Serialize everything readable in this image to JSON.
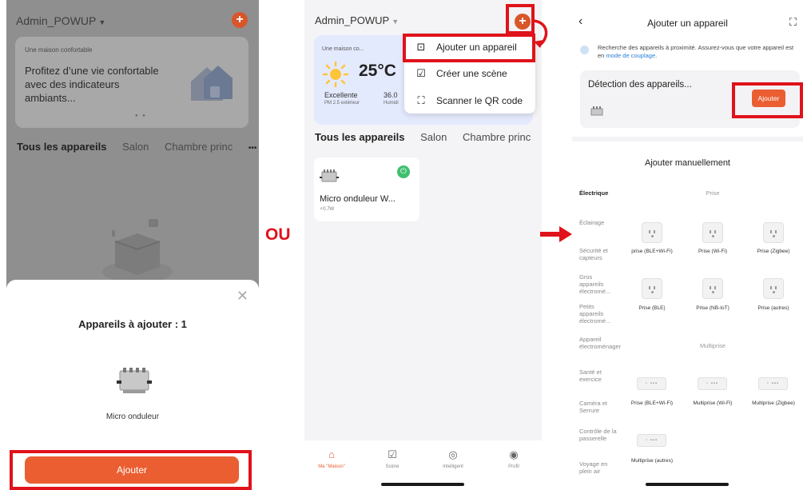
{
  "phone1": {
    "home_title": "Admin_POWUP",
    "card_small": "Une maison confortable",
    "card_big": "Profitez d’une vie confortable avec des indicateurs ambiants...",
    "tabs": [
      "Tous les appareils",
      "Salon",
      "Chambre princ"
    ],
    "more": "•••",
    "sheet": {
      "close": "✕",
      "title": "Appareils à ajouter : 1",
      "device_name": "Micro onduleur",
      "add_button": "Ajouter"
    }
  },
  "separator_text": "OU",
  "phone2": {
    "home_title": "Admin_POWUP",
    "card_location": "Une maison co...",
    "temperature": "25°C",
    "air_quality": "Excellente",
    "air_quality_sub": "PM 2.5 extérieur",
    "humidity": "36.0",
    "humidity_sub": "Humidi",
    "menu": [
      {
        "icon": "add-device-icon",
        "label": "Ajouter un appareil"
      },
      {
        "icon": "create-scene-icon",
        "label": "Créer une scène"
      },
      {
        "icon": "scan-qr-icon",
        "label": "Scanner le QR code"
      }
    ],
    "tabs": [
      "Tous les appareils",
      "Salon",
      "Chambre princ"
    ],
    "more": "•••",
    "device": {
      "name": "Micro onduleur W...",
      "power": "0.7W"
    },
    "nav": [
      {
        "icon": "home-icon",
        "label": "Ma \"Maison\""
      },
      {
        "icon": "scene-icon",
        "label": "Scène"
      },
      {
        "icon": "smart-icon",
        "label": "Intelligent"
      },
      {
        "icon": "profile-icon",
        "label": "Profil"
      }
    ]
  },
  "phone3": {
    "title": "Ajouter un appareil",
    "info_text": "Recherche des appareils à proximité. Assurez-vous que votre appareil est en ",
    "info_link": "mode de couplage",
    "info_end": ".",
    "detect_label": "Détection des appareils...",
    "detect_button": "Ajouter",
    "manual_title": "Ajouter manuellement",
    "categories": [
      "Électrique",
      "Éclairage",
      "Sécurité et capteurs",
      "Gros appareils électromé...",
      "Petits appareils électromé...",
      "Appareil électroménager",
      "Santé et exercice",
      "Caméra et Serrure",
      "Contrôle de la passerelle",
      "Voyage en plein air"
    ],
    "section_prise": "Prise",
    "section_multiprise": "Multiprise",
    "prise_labels": [
      "prise (BLE+Wi-Fi)",
      "Prise (Wi-Fi)",
      "Prise (Zigbee)",
      "Prise (BLE)",
      "Prise (NB-IoT)",
      "Prise (autres)"
    ],
    "multiprise_labels": [
      "Prise (BLE+Wi-Fi)",
      "Multiprise (Wi-Fi)",
      "Multiprise (Zigbee)",
      "Multiprise (autres)"
    ]
  },
  "colors": {
    "accent": "#ea5e32",
    "highlight": "#e0121b",
    "power_on": "#3fbf6c"
  }
}
